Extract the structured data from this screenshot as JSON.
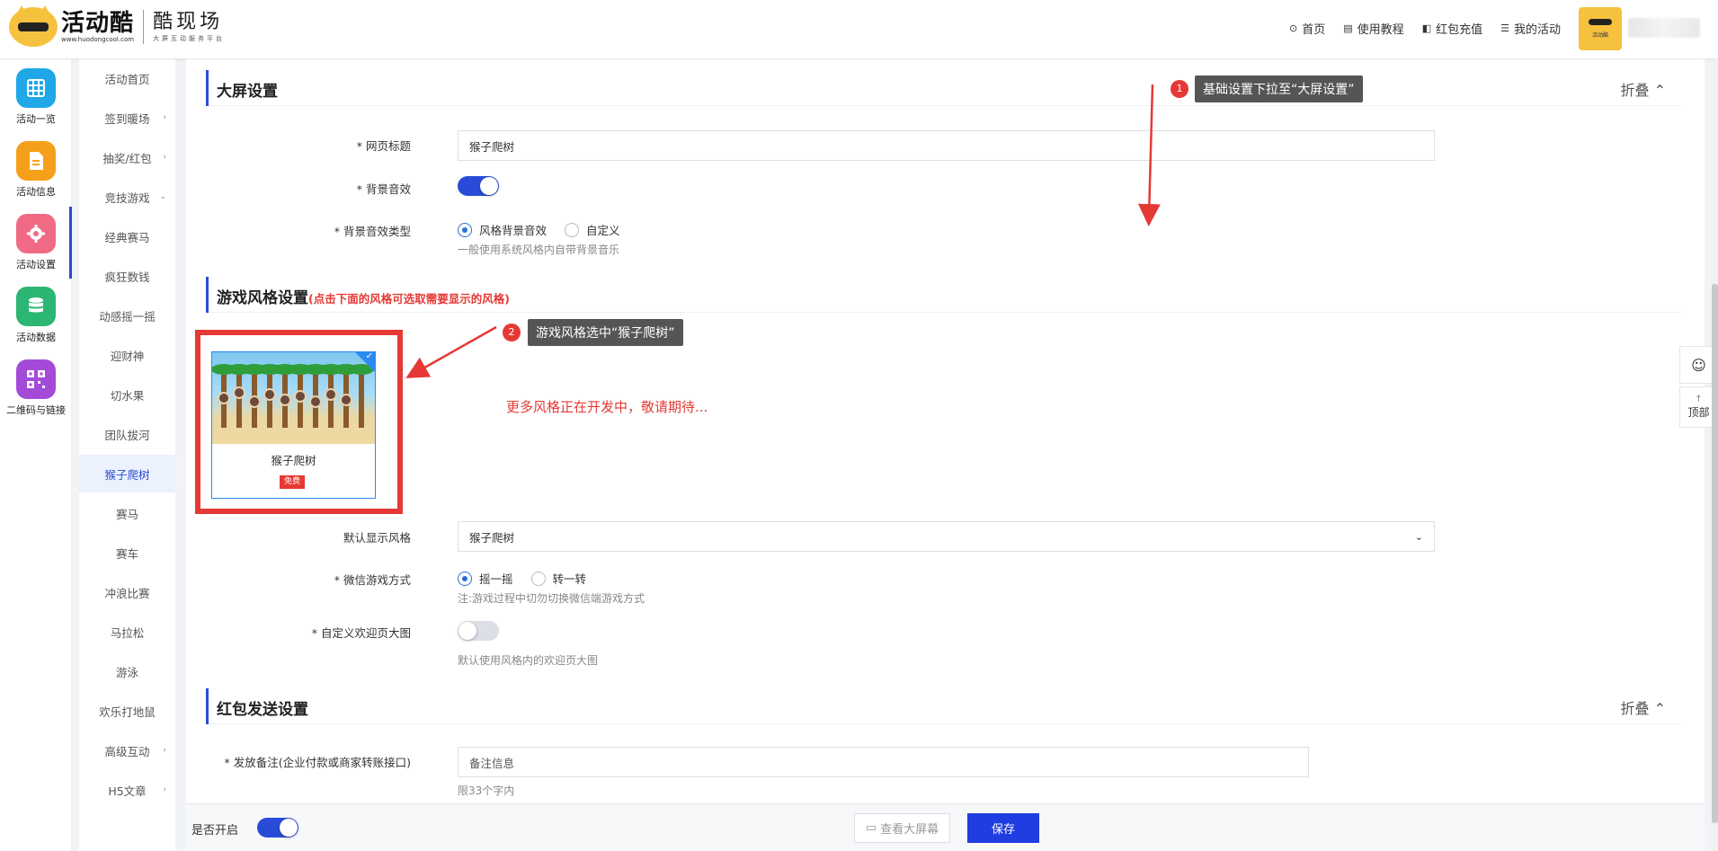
{
  "header": {
    "logo_main": "活动酷",
    "logo_url": "www.huodongcool.com",
    "logo_sub": "酷现场",
    "logo_tagline": "大屏互动服务平台",
    "nav": [
      {
        "label": "首页",
        "icon": "home-icon"
      },
      {
        "label": "使用教程",
        "icon": "book-icon"
      },
      {
        "label": "红包充值",
        "icon": "recharge-icon"
      },
      {
        "label": "我的活动",
        "icon": "list-icon"
      }
    ],
    "avatar_caption": "活动酷"
  },
  "rail": [
    {
      "label": "活动一览",
      "icon": "grid-icon",
      "color": "#1fa7e8"
    },
    {
      "label": "活动信息",
      "icon": "document-icon",
      "color": "#f5a01a"
    },
    {
      "label": "活动设置",
      "icon": "gear-icon",
      "color": "#f06a84"
    },
    {
      "label": "活动数据",
      "icon": "database-icon",
      "color": "#2bb673"
    },
    {
      "label": "二维码与链接",
      "icon": "qrcode-icon",
      "color": "#a44ad9"
    }
  ],
  "submenu": [
    {
      "label": "活动首页",
      "arrow": ""
    },
    {
      "label": "签到暖场",
      "arrow": "›"
    },
    {
      "label": "抽奖/红包",
      "arrow": "›"
    },
    {
      "label": "竞技游戏",
      "arrow": "⌄"
    },
    {
      "label": "经典赛马",
      "arrow": ""
    },
    {
      "label": "疯狂数钱",
      "arrow": ""
    },
    {
      "label": "动感摇一摇",
      "arrow": ""
    },
    {
      "label": "迎财神",
      "arrow": ""
    },
    {
      "label": "切水果",
      "arrow": ""
    },
    {
      "label": "团队拔河",
      "arrow": ""
    },
    {
      "label": "猴子爬树",
      "arrow": ""
    },
    {
      "label": "赛马",
      "arrow": ""
    },
    {
      "label": "赛车",
      "arrow": ""
    },
    {
      "label": "冲浪比赛",
      "arrow": ""
    },
    {
      "label": "马拉松",
      "arrow": ""
    },
    {
      "label": "游泳",
      "arrow": ""
    },
    {
      "label": "欢乐打地鼠",
      "arrow": ""
    },
    {
      "label": "高级互动",
      "arrow": "›"
    },
    {
      "label": "H5文章",
      "arrow": "›"
    }
  ],
  "submenu_active": "猴子爬树",
  "screen_settings": {
    "title": "大屏设置",
    "fold_label": "折叠 ⌃",
    "page_title_label": "* 网页标题",
    "page_title_value": "猴子爬树",
    "bg_sound_label": "* 背景音效",
    "bg_sound_on": true,
    "bg_sound_type_label": "* 背景音效类型",
    "bg_sound_type_options": [
      "风格背景音效",
      "自定义"
    ],
    "bg_sound_type_selected": "风格背景音效",
    "bg_sound_type_help": "一般使用系统风格内自带背景音乐"
  },
  "game_style": {
    "title": "游戏风格设置",
    "note": "(点击下面的风格可选取需要显示的风格)",
    "card_name": "猴子爬树",
    "card_badge": "免费",
    "more_styles": "更多风格正在开发中，敬请期待...",
    "default_style_label": "默认显示风格",
    "default_style_value": "猴子爬树",
    "wechat_mode_label": "* 微信游戏方式",
    "wechat_mode_options": [
      "摇一摇",
      "转一转"
    ],
    "wechat_mode_selected": "摇一摇",
    "wechat_mode_help": "注:游戏过程中切勿切换微信端游戏方式",
    "welcome_img_label": "* 自定义欢迎页大图",
    "welcome_img_on": false,
    "welcome_img_help": "默认使用风格内的欢迎页大图"
  },
  "redpacket": {
    "title": "红包发送设置",
    "fold_label": "折叠 ⌃",
    "remark_label": "* 发放备注(企业付款或商家转账接口)",
    "remark_placeholder": "备注信息",
    "remark_help": "限33个字内"
  },
  "tips": [
    {
      "num": "1",
      "text": "基础设置下拉至“大屏设置”"
    },
    {
      "num": "2",
      "text": "游戏风格选中“猴子爬树”"
    }
  ],
  "bottom": {
    "enable_label": "是否开启",
    "enable_on": true,
    "preview_label": "查看大屏幕",
    "save_label": "保存"
  },
  "float": {
    "qq_icon": "qq-icon",
    "top_label": "顶部"
  },
  "colors": {
    "primary": "#2a4bd7",
    "save": "#1f3de0",
    "alert": "#e53935"
  }
}
